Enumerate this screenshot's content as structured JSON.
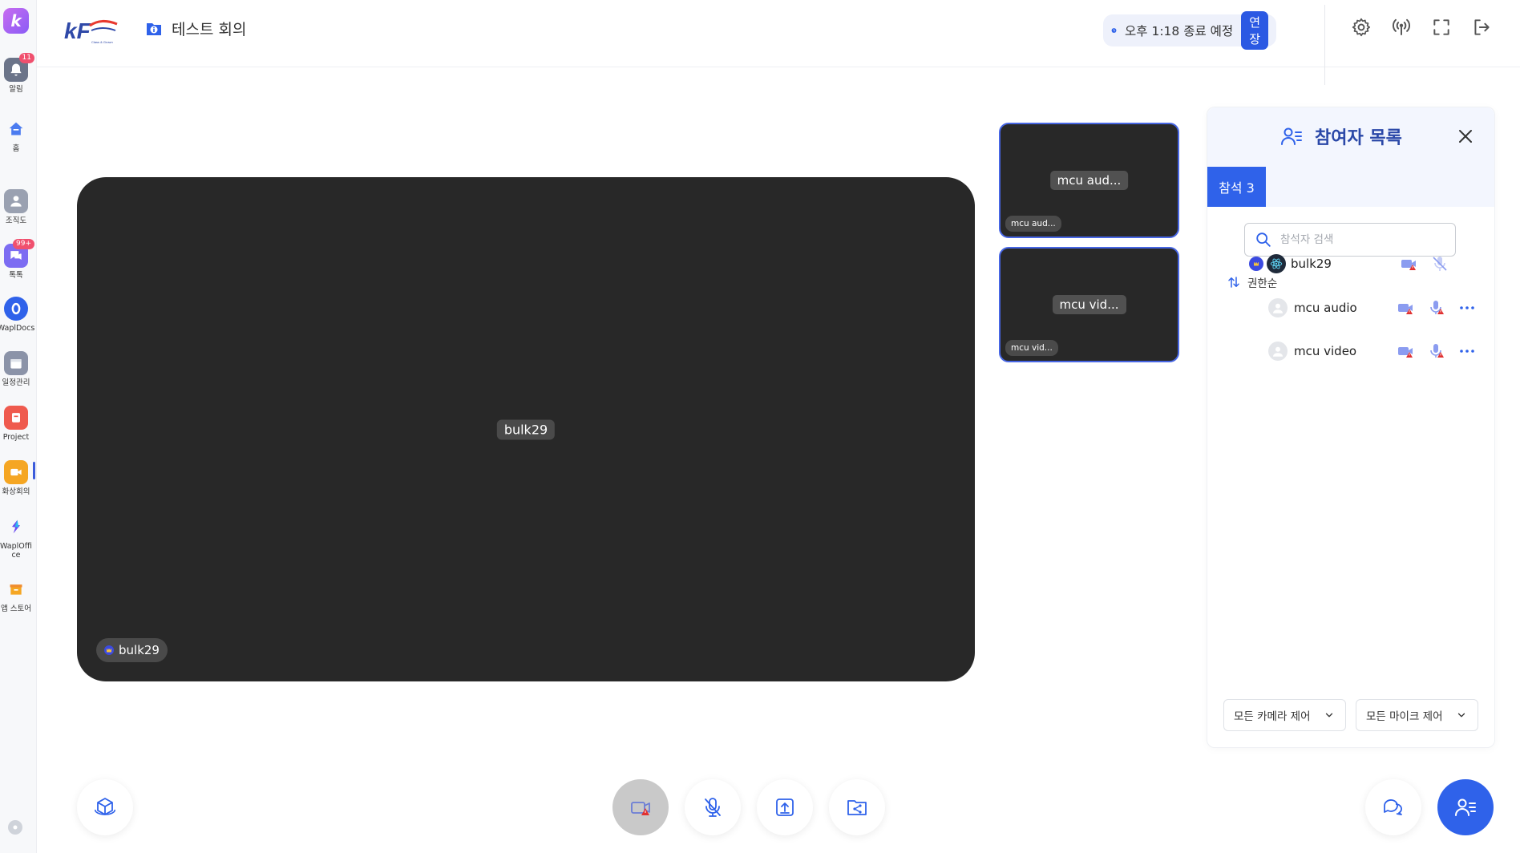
{
  "app": {
    "logo_letter": "k"
  },
  "rail": [
    {
      "label": "알림",
      "badge": "11"
    },
    {
      "label": "홈"
    },
    {
      "label": "조직도"
    },
    {
      "label": "톡톡",
      "badge": "99+"
    },
    {
      "label": "WaplDocs"
    },
    {
      "label": "일정관리"
    },
    {
      "label": "Project"
    },
    {
      "label": "화상회의"
    },
    {
      "label": "WaplOffice"
    },
    {
      "label": "앱 스토어"
    }
  ],
  "header": {
    "brand_text": "kF",
    "brand_sub": "Class & Grown",
    "meeting_title": "테스트 회의",
    "timer_text": "오후 1:18 종료 예정",
    "extend_label": "연장"
  },
  "stage": {
    "main_name": "bulk29",
    "main_corner_name": "bulk29",
    "tiles": [
      {
        "center": "mcu aud...",
        "corner": "mcu aud..."
      },
      {
        "center": "mcu vid...",
        "corner": "mcu vid..."
      }
    ]
  },
  "panel": {
    "title": "참여자 목록",
    "tab_label": "참석 3",
    "search_placeholder": "참석자 검색",
    "sort_label": "권한순",
    "participants": [
      {
        "name": "bulk29",
        "role": "host"
      },
      {
        "name": "mcu audio"
      },
      {
        "name": "mcu video"
      }
    ],
    "camera_control_label": "모든 카메라 제어",
    "mic_control_label": "모든 마이크 제어"
  },
  "colors": {
    "accent": "#2f62ea",
    "tile": "#282828",
    "panel_head": "#f3f6fe"
  }
}
